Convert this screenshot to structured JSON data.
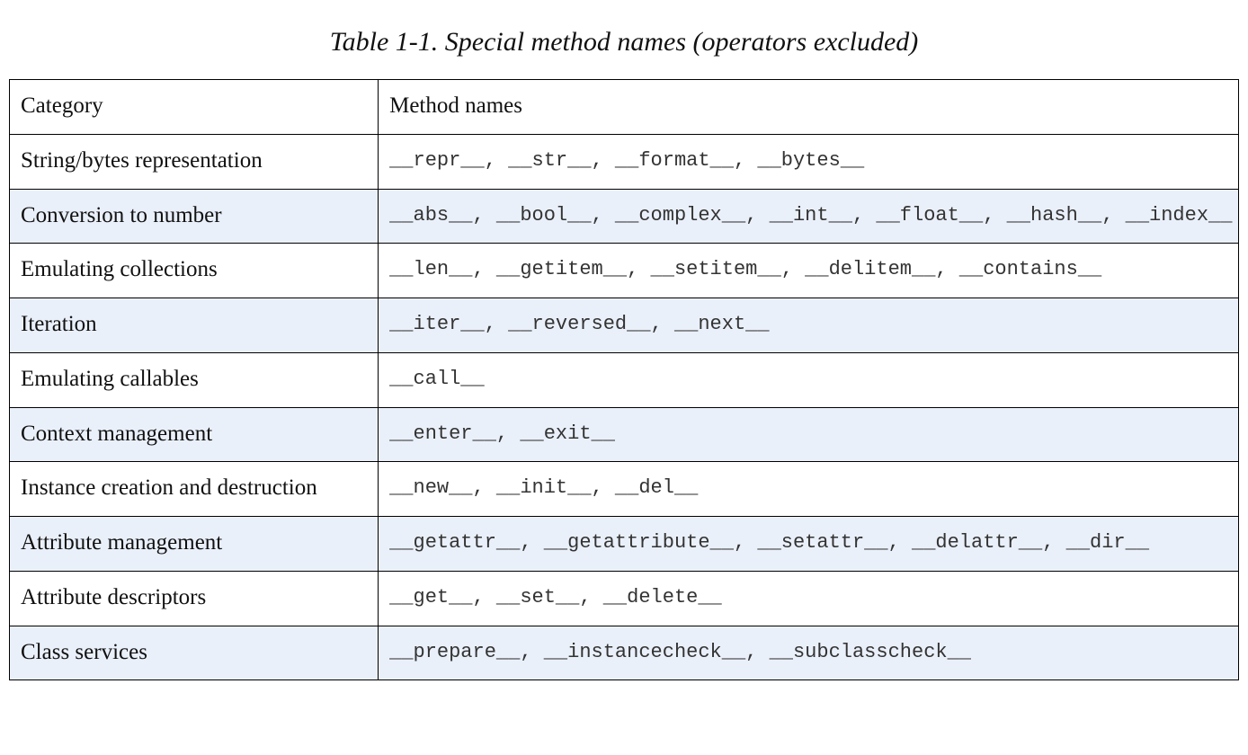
{
  "table": {
    "caption": "Table 1-1. Special method names (operators excluded)",
    "header": {
      "col1": "Category",
      "col2": "Method names"
    },
    "rows": [
      {
        "category": "String/bytes representation",
        "methods": "__repr__, __str__, __format__, __bytes__"
      },
      {
        "category": "Conversion to number",
        "methods": "__abs__, __bool__, __complex__, __int__, __float__, __hash__, __index__"
      },
      {
        "category": "Emulating collections",
        "methods": "__len__, __getitem__, __setitem__, __delitem__, __contains__"
      },
      {
        "category": "Iteration",
        "methods": "__iter__, __reversed__, __next__"
      },
      {
        "category": "Emulating callables",
        "methods": "__call__"
      },
      {
        "category": "Context management",
        "methods": "__enter__, __exit__"
      },
      {
        "category": "Instance creation and destruction",
        "methods": "__new__, __init__, __del__"
      },
      {
        "category": "Attribute management",
        "methods": "__getattr__, __getattribute__, __setattr__, __delattr__, __dir__"
      },
      {
        "category": "Attribute descriptors",
        "methods": "__get__, __set__, __delete__"
      },
      {
        "category": "Class services",
        "methods": "__prepare__, __instancecheck__, __subclasscheck__"
      }
    ]
  }
}
